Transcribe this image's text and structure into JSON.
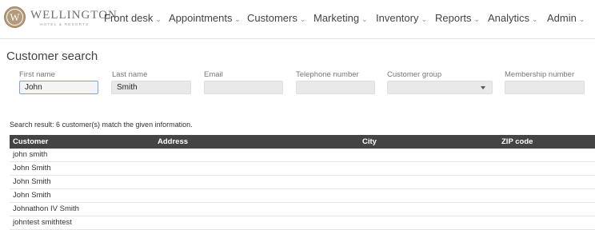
{
  "brand": {
    "logo_letter": "W",
    "name": "WELLINGTON",
    "subtitle": "HOTEL & RESORTS"
  },
  "nav": {
    "chevron": "⌄",
    "items": [
      {
        "label": "Front desk"
      },
      {
        "label": "Appointments"
      },
      {
        "label": "Customers"
      },
      {
        "label": "Marketing"
      },
      {
        "label": "Inventory"
      },
      {
        "label": "Reports"
      },
      {
        "label": "Analytics"
      },
      {
        "label": "Admin"
      }
    ]
  },
  "search": {
    "title": "Customer search",
    "fields": {
      "first_name": {
        "label": "First name",
        "value": "John"
      },
      "last_name": {
        "label": "Last name",
        "value": "Smith"
      },
      "email": {
        "label": "Email",
        "value": ""
      },
      "telephone": {
        "label": "Telephone number",
        "value": ""
      },
      "customer_group": {
        "label": "Customer group",
        "value": ""
      },
      "membership_number": {
        "label": "Membership number",
        "value": ""
      }
    },
    "result_text": "Search result: 6 customer(s) match the given information."
  },
  "table": {
    "columns": [
      "Customer",
      "Address",
      "City",
      "ZIP code"
    ],
    "rows": [
      {
        "customer": "john smith"
      },
      {
        "customer": "John Smith"
      },
      {
        "customer": "John Smith"
      },
      {
        "customer": "John Smith"
      },
      {
        "customer": "Johnathon IV Smith"
      },
      {
        "customer": "johntest smithtest"
      }
    ]
  },
  "colors": {
    "table_header_bg": "#444444",
    "logo_gold": "#b39a7a",
    "active_input_border": "#7aa7d6"
  }
}
